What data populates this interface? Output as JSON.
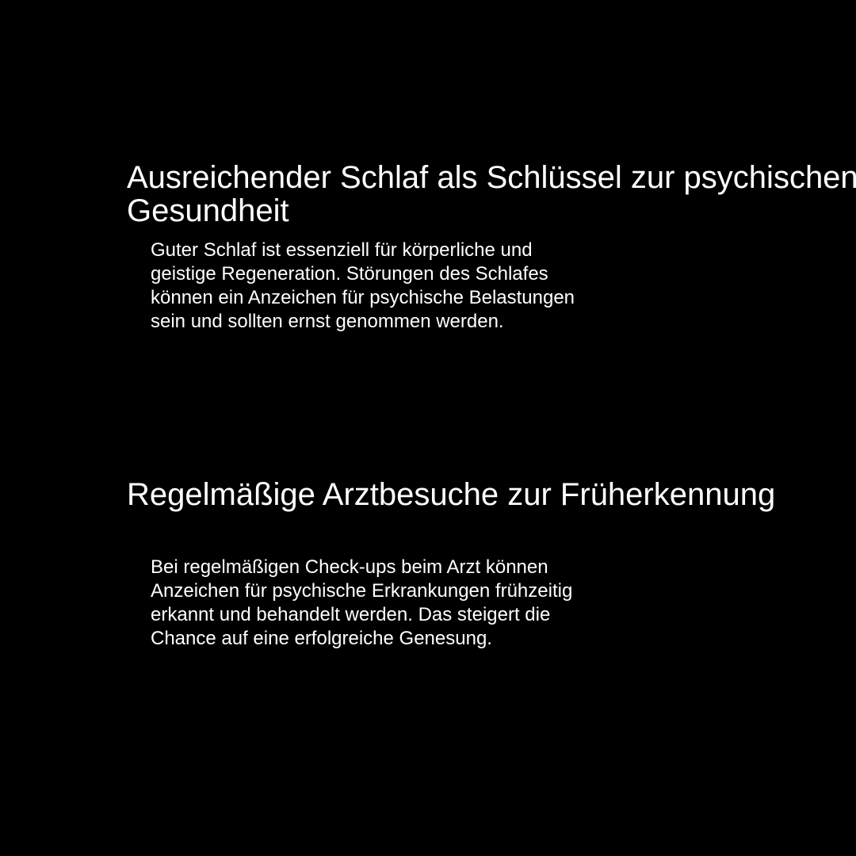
{
  "background_color": "#000000",
  "text_color": "#ffffff",
  "sections": [
    {
      "title_lines": [
        "Ausreichender Schlaf als Schlüssel zur psychischen",
        "Gesundheit"
      ],
      "body_lines": [
        "Guter Schlaf ist essenziell für körperliche und",
        "geistige Regeneration. Störungen des Schlafes",
        "können ein Anzeichen für psychische Belastungen",
        "sein und sollten ernst genommen werden."
      ]
    },
    {
      "title_lines": [
        "Regelmäßige Arztbesuche zur Früherkennung"
      ],
      "body_lines": [
        "Bei regelmäßigen Check-ups beim Arzt können",
        "Anzeichen für psychische Erkrankungen frühzeitig",
        "erkannt und behandelt werden. Das steigert die",
        "Chance auf eine erfolgreiche Genesung."
      ]
    }
  ]
}
